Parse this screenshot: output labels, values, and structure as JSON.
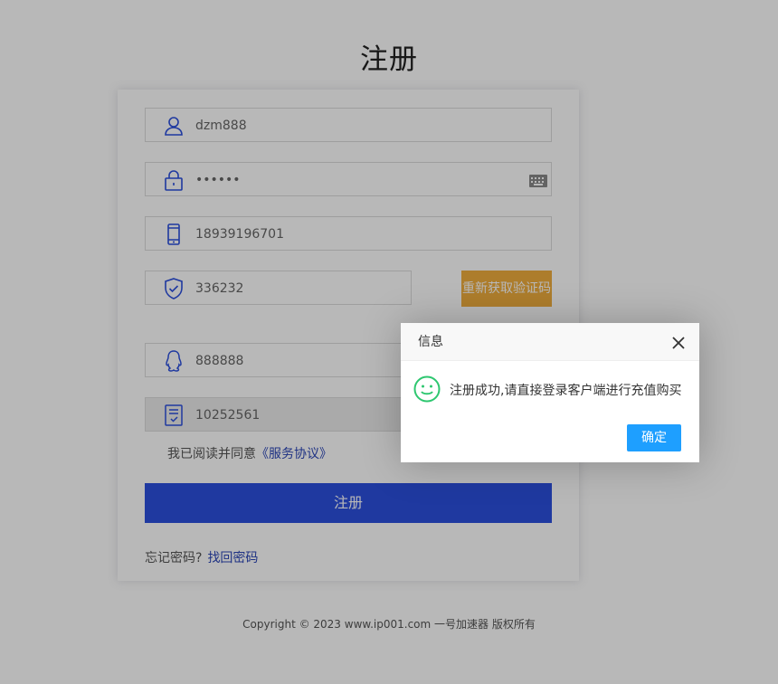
{
  "page": {
    "title": "注册"
  },
  "form": {
    "username": "dzm888",
    "password": "••••••",
    "phone": "18939196701",
    "verify_code": "336232",
    "resend_code_label": "重新获取验证码",
    "qq": "888888",
    "invite_code": "10252561",
    "agree_text": "我已阅读并同意",
    "agreement_link": "《服务协议》",
    "submit_label": "注册",
    "forgot_text": "忘记密码?",
    "recover_link": "找回密码"
  },
  "footer": {
    "copyright": "Copyright © 2023 www.ip001.com 一号加速器 版权所有"
  },
  "dialog": {
    "title": "信息",
    "message": "注册成功,请直接登录客户端进行充值购买",
    "ok_label": "确定"
  },
  "colors": {
    "icon_blue": "#2b4fde",
    "submit_blue": "#2b4fde",
    "resend_orange": "#f0ad3d",
    "dialog_ok_blue": "#1e9fff",
    "smile_green": "#2ec770"
  },
  "icons": [
    "user-icon",
    "lock-icon",
    "keyboard-icon",
    "phone-icon",
    "shield-check-icon",
    "qq-icon",
    "invite-code-icon",
    "close-icon",
    "smile-icon"
  ]
}
